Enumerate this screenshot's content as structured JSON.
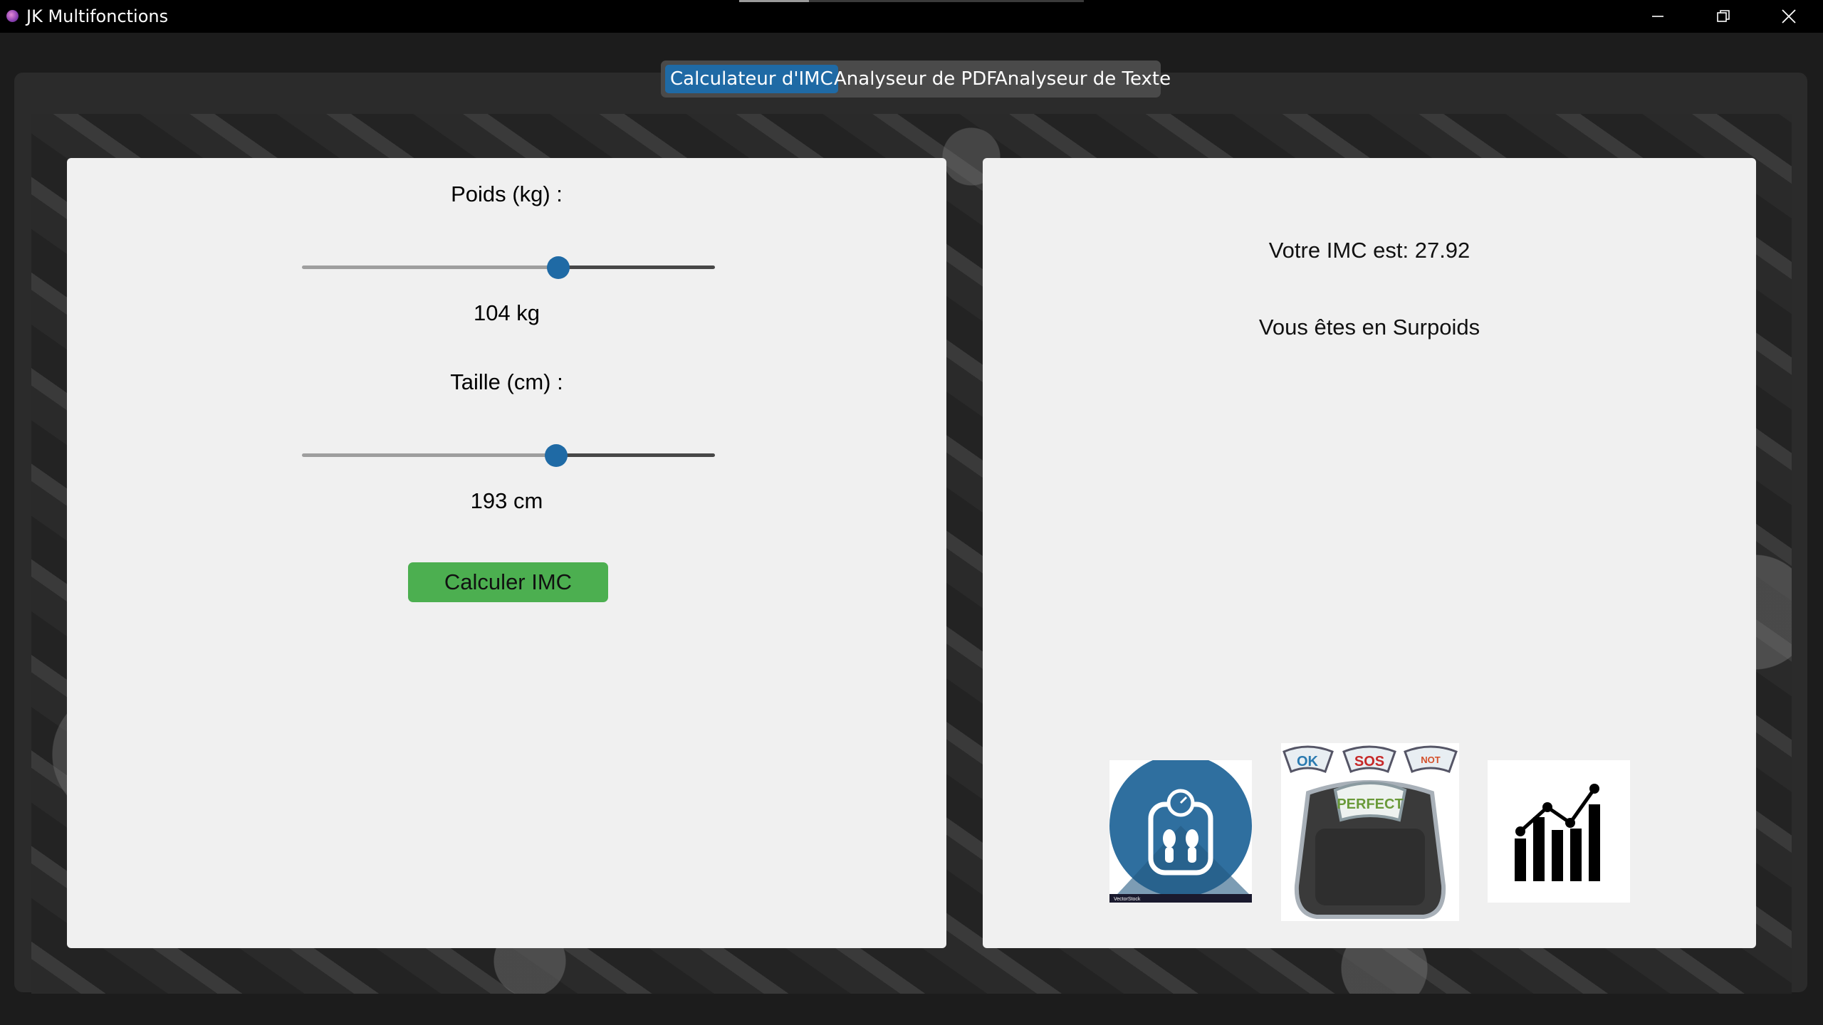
{
  "window": {
    "title": "JK Multifonctions"
  },
  "tabs": [
    {
      "label": "Calculateur d'IMC",
      "active": true
    },
    {
      "label": "Analyseur de PDF",
      "active": false
    },
    {
      "label": "Analyseur de Texte",
      "active": false
    }
  ],
  "calculator": {
    "weight_label": "Poids (kg) :",
    "weight_value": "104 kg",
    "weight_slider_fraction": 0.62,
    "height_label": "Taille (cm) :",
    "height_value": "193 cm",
    "height_slider_fraction": 0.615,
    "button_label": "Calculer IMC"
  },
  "result": {
    "imc_text": "Votre IMC est: 27.92",
    "category_text": "Vous êtes en Surpoids"
  },
  "images": {
    "scale_logo_text": "VectorStock",
    "scale_dial_ok": "OK",
    "scale_dial_sos": "SOS",
    "scale_dial_not": "NOT",
    "scale_main_text": "PERFECT"
  },
  "colors": {
    "accent": "#1f6aa5",
    "button": "#4caf50",
    "panel": "#f0f0f0"
  },
  "icons": [
    "minimize-icon",
    "restore-icon",
    "close-icon",
    "scale-icon",
    "bar-chart-icon"
  ]
}
